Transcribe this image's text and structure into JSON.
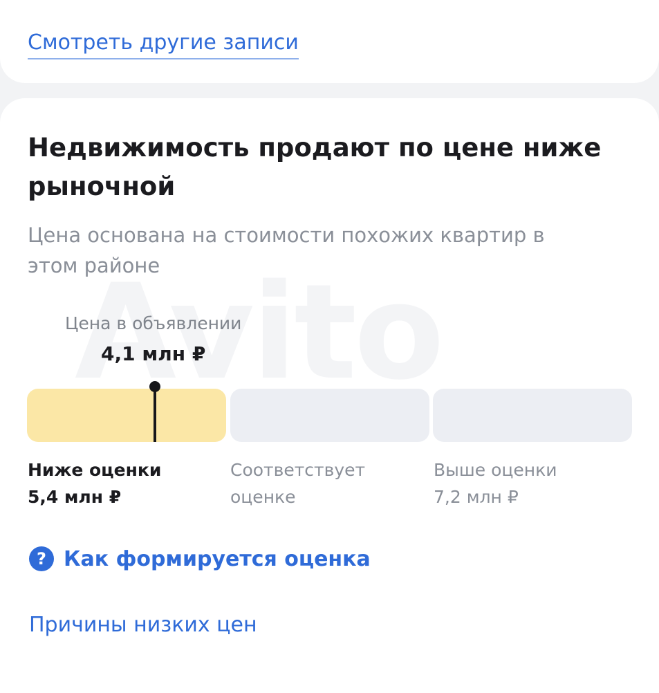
{
  "top_card": {
    "more_link": "Смотреть другие записи"
  },
  "estimate": {
    "title": "Недвижимость продают по цене ниже рыночной",
    "subtitle": "Цена основана на стоимости похожих квартир в этом районе",
    "watermark": "Avito",
    "listing_price_caption": "Цена в объявлении",
    "listing_price_value": "4,1 млн ₽",
    "segments": [
      {
        "label_line1": "Ниже оценки",
        "label_line2": "5,4 млн ₽",
        "color": "#fbe7a6",
        "active": true
      },
      {
        "label_line1": "Соответствует",
        "label_line2": "оценке",
        "color": "#eceef3",
        "active": false
      },
      {
        "label_line1": "Выше оценки",
        "label_line2": "7,2 млн ₽",
        "color": "#eceef3",
        "active": false
      }
    ],
    "how_link": {
      "icon": "question-circle-icon",
      "icon_glyph": "?",
      "label": "Как формируется оценка"
    },
    "reasons_link": "Причины низких цен"
  },
  "colors": {
    "link_blue": "#2f6bd8",
    "accent_yellow": "#fbe7a6",
    "muted_text": "#8a8f98"
  }
}
